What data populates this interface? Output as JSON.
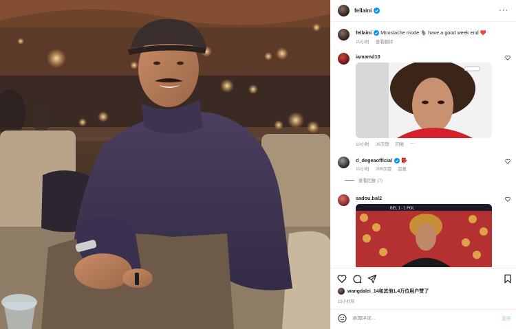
{
  "post": {
    "author": "fellaini",
    "caption_user": "fellaini",
    "caption_text": "Moustache mode 🐐 have a good week end ❤️",
    "caption_time": "15小时",
    "caption_translate": "查看翻译"
  },
  "comments": [
    {
      "user": "iamamd10",
      "time": "13小时",
      "likes": "26次赞",
      "reply": "回复"
    },
    {
      "user": "d_degeaofficial",
      "badge": "👺",
      "time": "15小时",
      "likes": "265次赞",
      "reply": "回复",
      "view_replies": "查看回复 (7)"
    },
    {
      "user": "sadou.bal2",
      "score": "BEL  1 - 1  POL"
    }
  ],
  "footer": {
    "liked_by": "wangdalei_14和其他1.4万位用户赞了",
    "time": "15小时前",
    "comment_placeholder": "添加评论...",
    "post_label": "发布"
  },
  "colors": {
    "verified": "#0095f6",
    "red_heart": "#ed4956",
    "post_disabled": "#b2dffc"
  },
  "icons": [
    "verified-badge-icon",
    "more-options-icon",
    "heart-icon",
    "comment-icon",
    "share-icon",
    "bookmark-icon",
    "emoji-icon"
  ]
}
